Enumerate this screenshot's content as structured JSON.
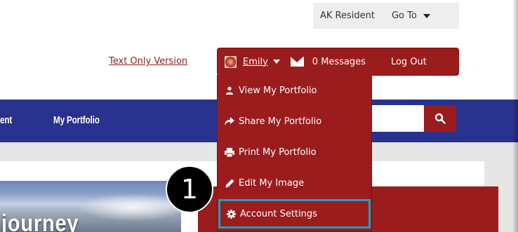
{
  "utility_bar": {
    "resident_label": "AK Resident",
    "goto_label": "Go To"
  },
  "text_only_link": "Text Only Version",
  "user_bar": {
    "user_name": "Emily",
    "messages_label": "0 Messages",
    "logout_label": "Log Out"
  },
  "nav": {
    "items": [
      {
        "label": "ent"
      },
      {
        "label": "My Portfolio"
      }
    ]
  },
  "user_menu": {
    "items": [
      {
        "label": "View My Portfolio",
        "icon": "user-icon"
      },
      {
        "label": "Share My Portfolio",
        "icon": "share-arrow-icon"
      },
      {
        "label": "Print My Portfolio",
        "icon": "printer-icon"
      },
      {
        "label": "Edit My Image",
        "icon": "pencil-icon"
      },
      {
        "label": "Account Settings",
        "icon": "gear-icon"
      }
    ]
  },
  "hero_text": "journey",
  "step_badge": "1",
  "colors": {
    "brand_red": "#9b1c1c",
    "nav_blue": "#28338f",
    "highlight": "#19a2c3"
  }
}
